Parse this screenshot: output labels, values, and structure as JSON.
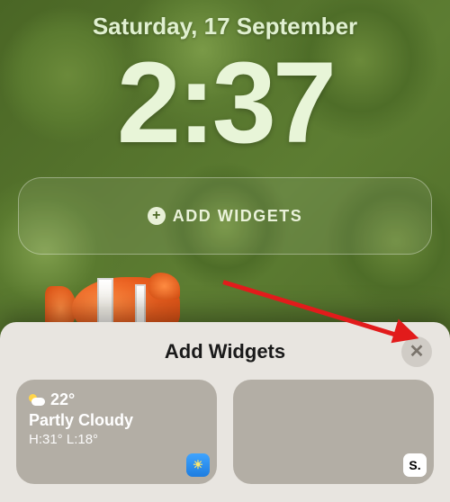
{
  "lockscreen": {
    "date": "Saturday, 17 September",
    "time": "2:37",
    "add_widgets_label": "ADD WIDGETS"
  },
  "sheet": {
    "title": "Add Widgets"
  },
  "widgets": {
    "weather": {
      "temp": "22°",
      "condition": "Partly Cloudy",
      "hilo": "H:31° L:18°"
    },
    "badge_s": "S."
  }
}
